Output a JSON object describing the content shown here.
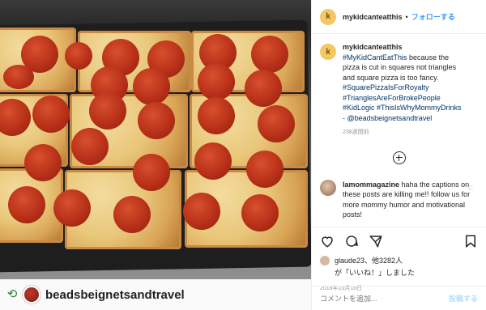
{
  "post": {
    "username": "mykidcanteatthis",
    "avatar_initial": "k",
    "dot": "•",
    "follow_label": "フォローする",
    "caption_lines": [
      "#MyKidCantEatThis because the",
      "pizza is cut in squares not triangles",
      "and square pizza is too fancy.",
      "#SquarePizzaIsForRoyalty",
      "#TrianglesAreForBrokePeople",
      "#KidLogic #ThisIsWhyMommyDrinks",
      "- @beadsbeignetsandtravel"
    ],
    "caption_age": "238週間前",
    "comment": {
      "username": "lamommagazine",
      "text": "haha the captions on these posts are killing me!! follow us for more mommy humor and motivational posts!"
    },
    "likes_line1": "glaude23、他3282人",
    "likes_line2": "が「いいね！」しました",
    "date": "2018年10月18日",
    "add_comment_placeholder": "コメントを追加...",
    "post_button": "投稿する"
  },
  "repost": {
    "username": "beadsbeignetsandtravel"
  },
  "icons": {
    "repost": "repost-icon",
    "heart": "heart-icon",
    "comment": "comment-icon",
    "share": "share-icon",
    "bookmark": "bookmark-icon",
    "add": "plus-circle-icon"
  },
  "colors": {
    "link_blue": "#3897f0",
    "hashtag": "#003569",
    "post_disabled": "#b2dffc"
  }
}
